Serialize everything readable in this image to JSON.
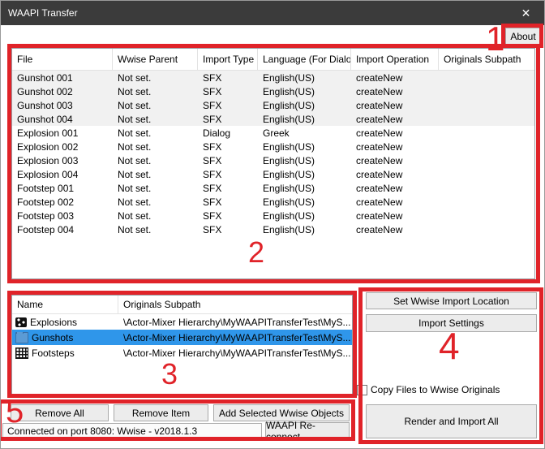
{
  "window": {
    "title": "WAAPI Transfer",
    "close_icon": "✕"
  },
  "about_button": "About",
  "annotations": {
    "one": "1",
    "two": "2",
    "three": "3",
    "four": "4",
    "five": "5"
  },
  "colors": {
    "annotation_red": "#e02329",
    "selection_blue": "#2f96ea",
    "titlebar": "#3b3b3b"
  },
  "file_table": {
    "columns": [
      "File",
      "Wwise Parent",
      "Import Type",
      "Language (For Dialog)",
      "Import Operation",
      "Originals Subpath"
    ],
    "rows": [
      {
        "file": "Gunshot 001",
        "parent": "Not set.",
        "type": "SFX",
        "language": "English(US)",
        "operation": "createNew",
        "subpath": "",
        "shaded": true
      },
      {
        "file": "Gunshot 002",
        "parent": "Not set.",
        "type": "SFX",
        "language": "English(US)",
        "operation": "createNew",
        "subpath": "",
        "shaded": true
      },
      {
        "file": "Gunshot 003",
        "parent": "Not set.",
        "type": "SFX",
        "language": "English(US)",
        "operation": "createNew",
        "subpath": "",
        "shaded": true
      },
      {
        "file": "Gunshot 004",
        "parent": "Not set.",
        "type": "SFX",
        "language": "English(US)",
        "operation": "createNew",
        "subpath": "",
        "shaded": true
      },
      {
        "file": "Explosion 001",
        "parent": "Not set.",
        "type": "Dialog",
        "language": "Greek",
        "operation": "createNew",
        "subpath": "",
        "shaded": false
      },
      {
        "file": "Explosion 002",
        "parent": "Not set.",
        "type": "SFX",
        "language": "English(US)",
        "operation": "createNew",
        "subpath": "",
        "shaded": false
      },
      {
        "file": "Explosion 003",
        "parent": "Not set.",
        "type": "SFX",
        "language": "English(US)",
        "operation": "createNew",
        "subpath": "",
        "shaded": false
      },
      {
        "file": "Explosion 004",
        "parent": "Not set.",
        "type": "SFX",
        "language": "English(US)",
        "operation": "createNew",
        "subpath": "",
        "shaded": false
      },
      {
        "file": "Footstep 001",
        "parent": "Not set.",
        "type": "SFX",
        "language": "English(US)",
        "operation": "createNew",
        "subpath": "",
        "shaded": false
      },
      {
        "file": "Footstep 002",
        "parent": "Not set.",
        "type": "SFX",
        "language": "English(US)",
        "operation": "createNew",
        "subpath": "",
        "shaded": false
      },
      {
        "file": "Footstep 003",
        "parent": "Not set.",
        "type": "SFX",
        "language": "English(US)",
        "operation": "createNew",
        "subpath": "",
        "shaded": false
      },
      {
        "file": "Footstep 004",
        "parent": "Not set.",
        "type": "SFX",
        "language": "English(US)",
        "operation": "createNew",
        "subpath": "",
        "shaded": false
      }
    ]
  },
  "wwise_table": {
    "columns": [
      "Name",
      "Originals Subpath"
    ],
    "rows": [
      {
        "name": "Explosions",
        "subpath": "\\Actor-Mixer Hierarchy\\MyWAAPITransferTest\\MyS...",
        "icon": "random-container-icon",
        "selected": false
      },
      {
        "name": "Gunshots",
        "subpath": "\\Actor-Mixer Hierarchy\\MyWAAPITransferTest\\MyS...",
        "icon": "folder-icon",
        "selected": true
      },
      {
        "name": "Footsteps",
        "subpath": "\\Actor-Mixer Hierarchy\\MyWAAPITransferTest\\MyS...",
        "icon": "blend-container-icon",
        "selected": false
      }
    ]
  },
  "right_panel": {
    "set_import_location": "Set Wwise Import Location",
    "import_settings": "Import Settings",
    "copy_files_label": "Copy Files to Wwise Originals",
    "copy_files_checked": false,
    "render_and_import": "Render and Import All"
  },
  "bottom_bar": {
    "remove_all": "Remove All",
    "remove_item": "Remove Item",
    "add_selected": "Add Selected Wwise Objects",
    "status": "Connected on port 8080: Wwise - v2018.1.3",
    "reconnect": "WAAPI Re-connect"
  }
}
